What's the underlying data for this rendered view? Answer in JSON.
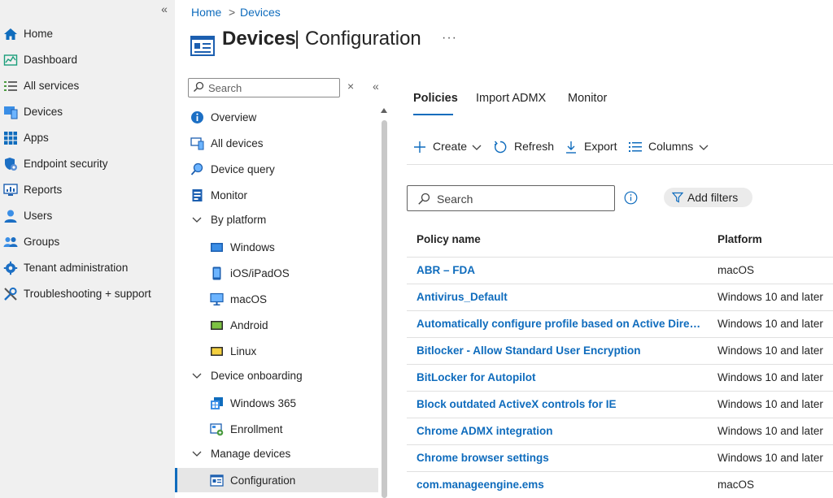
{
  "leftnav": {
    "collapse_glyph": "«",
    "items": [
      {
        "label": "Home",
        "icon": "home-icon"
      },
      {
        "label": "Dashboard",
        "icon": "dashboard-icon"
      },
      {
        "label": "All services",
        "icon": "list-icon"
      },
      {
        "label": "Devices",
        "icon": "devices-icon"
      },
      {
        "label": "Apps",
        "icon": "apps-grid-icon"
      },
      {
        "label": "Endpoint security",
        "icon": "shield-icon"
      },
      {
        "label": "Reports",
        "icon": "reports-icon"
      },
      {
        "label": "Users",
        "icon": "user-icon"
      },
      {
        "label": "Groups",
        "icon": "groups-icon"
      },
      {
        "label": "Tenant administration",
        "icon": "gear-icon"
      },
      {
        "label": "Troubleshooting + support",
        "icon": "wrench-icon"
      }
    ]
  },
  "breadcrumb": {
    "home": "Home",
    "separator": ">",
    "current": "Devices"
  },
  "header": {
    "title": "Devices",
    "separator": "|",
    "subtitle": "Configuration",
    "more": "···"
  },
  "subnav": {
    "search_placeholder": "Search",
    "close_glyph": "×",
    "collapse_glyph": "«",
    "items": [
      {
        "label": "Overview"
      },
      {
        "label": "All devices"
      },
      {
        "label": "Device query"
      },
      {
        "label": "Monitor"
      },
      {
        "label": "By platform"
      },
      {
        "label": "Windows"
      },
      {
        "label": "iOS/iPadOS"
      },
      {
        "label": "macOS"
      },
      {
        "label": "Android"
      },
      {
        "label": "Linux"
      },
      {
        "label": "Device onboarding"
      },
      {
        "label": "Windows 365"
      },
      {
        "label": "Enrollment"
      },
      {
        "label": "Manage devices"
      },
      {
        "label": "Configuration"
      }
    ]
  },
  "tabs": [
    {
      "label": "Policies"
    },
    {
      "label": "Import ADMX"
    },
    {
      "label": "Monitor"
    }
  ],
  "toolbar": {
    "create": "Create",
    "refresh": "Refresh",
    "export": "Export",
    "columns": "Columns"
  },
  "search": {
    "placeholder": "Search"
  },
  "filters": {
    "label": "Add filters"
  },
  "table": {
    "headers": {
      "name": "Policy name",
      "platform": "Platform"
    },
    "rows": [
      {
        "name": "ABR – FDA",
        "platform": "macOS"
      },
      {
        "name": "Antivirus_Default",
        "platform": "Windows 10 and later"
      },
      {
        "name": "Automatically configure profile based on Active Directory...",
        "platform": "Windows 10 and later"
      },
      {
        "name": "Bitlocker - Allow Standard User Encryption",
        "platform": "Windows 10 and later"
      },
      {
        "name": "BitLocker for Autopilot",
        "platform": "Windows 10 and later"
      },
      {
        "name": "Block outdated ActiveX controls for IE",
        "platform": "Windows 10 and later"
      },
      {
        "name": "Chrome ADMX integration",
        "platform": "Windows 10 and later"
      },
      {
        "name": "Chrome browser settings",
        "platform": "Windows 10 and later"
      },
      {
        "name": "com.manageengine.ems",
        "platform": "macOS"
      }
    ]
  },
  "colors": {
    "accent": "#0f6cbd",
    "nav_bg": "#f0f0f0",
    "text": "#242424"
  }
}
